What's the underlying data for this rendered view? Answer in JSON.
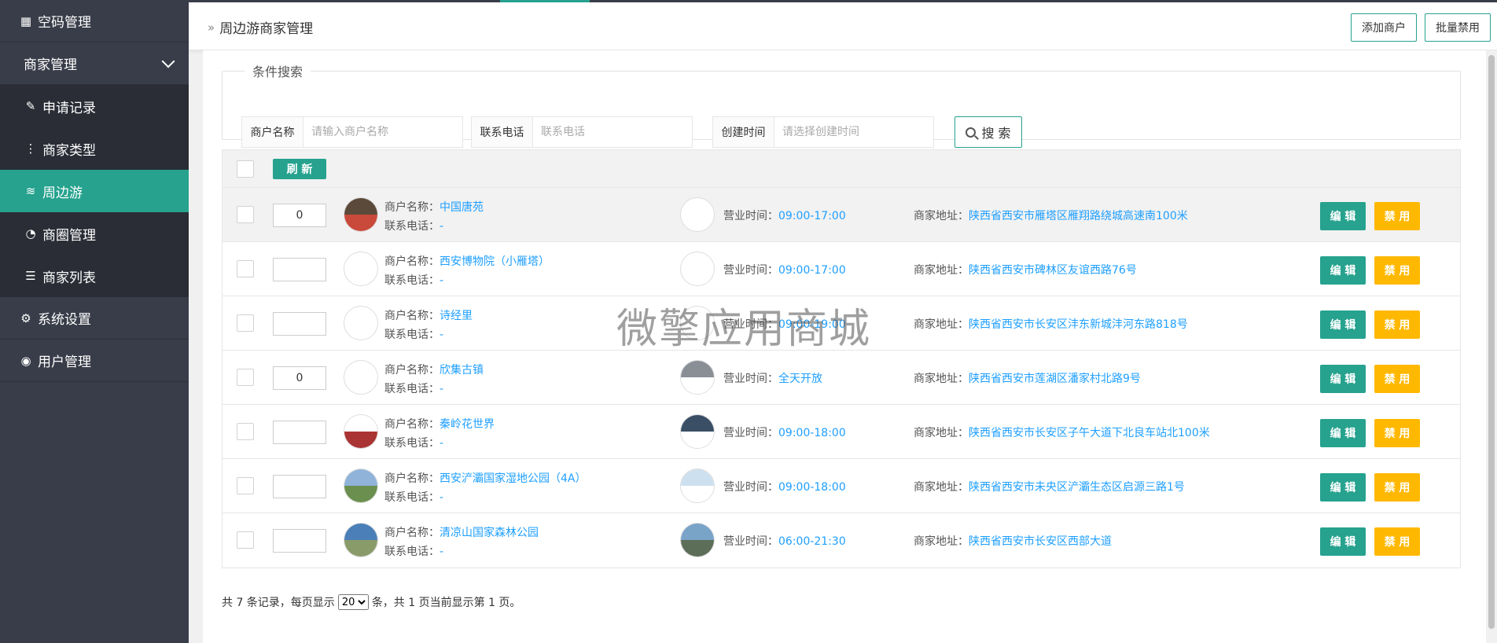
{
  "sidebar": {
    "items": [
      {
        "label": "空码管理",
        "icon": "qrcode-icon"
      },
      {
        "label": "商家管理",
        "icon": "chevron-down-icon"
      },
      {
        "label": "申请记录",
        "icon": "pencil-icon"
      },
      {
        "label": "商家类型",
        "icon": "dots-vertical-icon"
      },
      {
        "label": "周边游",
        "icon": "layers-icon"
      },
      {
        "label": "商圈管理",
        "icon": "rss-icon"
      },
      {
        "label": "商家列表",
        "icon": "list-icon"
      },
      {
        "label": "系统设置",
        "icon": "gear-icon"
      },
      {
        "label": "用户管理",
        "icon": "user-icon"
      }
    ],
    "active": "周边游"
  },
  "header": {
    "breadcrumb": "周边游商家管理",
    "add_button": "添加商户",
    "batch_disable_button": "批量禁用"
  },
  "search": {
    "legend": "条件搜索",
    "name_label": "商户名称",
    "name_placeholder": "请输入商户名称",
    "phone_label": "联系电话",
    "phone_placeholder": "联系电话",
    "date_label": "创建时间",
    "date_placeholder": "请选择创建时间",
    "button": "搜 索"
  },
  "table": {
    "refresh_button": "刷 新",
    "name_prefix": "商户名称：",
    "phone_prefix": "联系电话：",
    "hours_prefix": "营业时间：",
    "address_prefix": "商家地址：",
    "edit_label": "编 辑",
    "disable_label": "禁 用",
    "rows": [
      {
        "sort": "0",
        "name": "中国唐苑",
        "phone": "-",
        "hours": "09:00-17:00",
        "address": "陕西省西安市雁塔区雁翔路绕城高速南100米"
      },
      {
        "sort": "",
        "name": "西安博物院（小雁塔）",
        "phone": "-",
        "hours": "09:00-17:00",
        "address": "陕西省西安市碑林区友谊西路76号"
      },
      {
        "sort": "",
        "name": "诗经里",
        "phone": "-",
        "hours": "09:00-19:00",
        "address": "陕西省西安市长安区沣东新城沣河东路818号"
      },
      {
        "sort": "0",
        "name": "欣集古镇",
        "phone": "-",
        "hours": "全天开放",
        "address": "陕西省西安市莲湖区潘家村北路9号"
      },
      {
        "sort": "",
        "name": "秦岭花世界",
        "phone": "-",
        "hours": "09:00-18:00",
        "address": "陕西省西安市长安区子午大道下北良车站北100米"
      },
      {
        "sort": "",
        "name": "西安浐灞国家湿地公园（4A）",
        "phone": "-",
        "hours": "09:00-18:00",
        "address": "陕西省西安市未央区浐灞生态区启源三路1号"
      },
      {
        "sort": "",
        "name": "清凉山国家森林公园",
        "phone": "-",
        "hours": "06:00-21:30",
        "address": "陕西省西安市长安区西部大道"
      }
    ]
  },
  "pager": {
    "prefix": "共 7 条记录，每页显示",
    "page_size": "20",
    "suffix": "条，共 1 页当前显示第 1 页。"
  },
  "watermark": "微擎应用商城",
  "colors": {
    "primary": "#26a28e",
    "warning": "#ffb800",
    "link": "#1e9fff",
    "sidebar": "#393d49"
  }
}
